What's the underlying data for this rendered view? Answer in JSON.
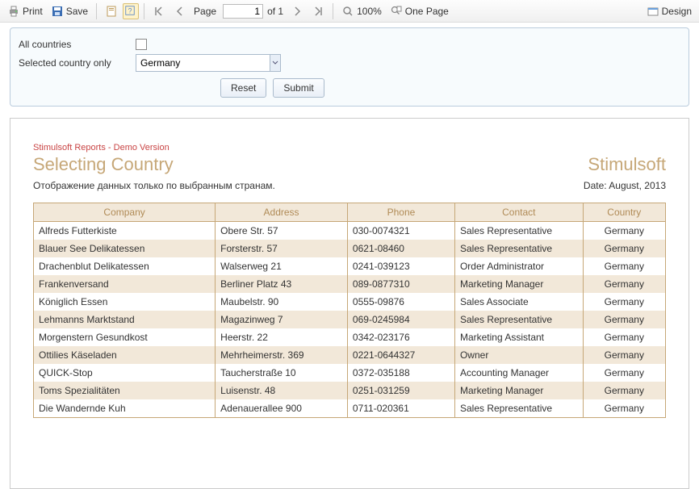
{
  "toolbar": {
    "print": "Print",
    "save": "Save",
    "page_label": "Page",
    "page_input": "1",
    "page_of": "of 1",
    "zoom": "100%",
    "one_page": "One Page",
    "design": "Design"
  },
  "params": {
    "all_label": "All countries",
    "selected_label": "Selected country only",
    "combo_value": "Germany",
    "reset": "Reset",
    "submit": "Submit"
  },
  "report": {
    "demo": "Stimulsoft Reports - Demo Version",
    "title": "Selecting Country",
    "brand": "Stimulsoft",
    "subtitle": "Отображение данных только по выбранным странам.",
    "date": "Date: August, 2013",
    "headers": {
      "company": "Company",
      "address": "Address",
      "phone": "Phone",
      "contact": "Contact",
      "country": "Country"
    },
    "rows": [
      {
        "company": "Alfreds Futterkiste",
        "address": "Obere Str. 57",
        "phone": "030-0074321",
        "contact": "Sales Representative",
        "country": "Germany"
      },
      {
        "company": "Blauer See Delikatessen",
        "address": "Forsterstr. 57",
        "phone": "0621-08460",
        "contact": "Sales Representative",
        "country": "Germany"
      },
      {
        "company": "Drachenblut Delikatessen",
        "address": "Walserweg 21",
        "phone": "0241-039123",
        "contact": "Order Administrator",
        "country": "Germany"
      },
      {
        "company": "Frankenversand",
        "address": "Berliner Platz 43",
        "phone": "089-0877310",
        "contact": "Marketing Manager",
        "country": "Germany"
      },
      {
        "company": "Königlich Essen",
        "address": "Maubelstr. 90",
        "phone": "0555-09876",
        "contact": "Sales Associate",
        "country": "Germany"
      },
      {
        "company": "Lehmanns Marktstand",
        "address": "Magazinweg 7",
        "phone": "069-0245984",
        "contact": "Sales Representative",
        "country": "Germany"
      },
      {
        "company": "Morgenstern Gesundkost",
        "address": "Heerstr. 22",
        "phone": "0342-023176",
        "contact": "Marketing Assistant",
        "country": "Germany"
      },
      {
        "company": "Ottilies Käseladen",
        "address": "Mehrheimerstr. 369",
        "phone": "0221-0644327",
        "contact": "Owner",
        "country": "Germany"
      },
      {
        "company": "QUICK-Stop",
        "address": "Taucherstraße 10",
        "phone": "0372-035188",
        "contact": "Accounting Manager",
        "country": "Germany"
      },
      {
        "company": "Toms Spezialitäten",
        "address": "Luisenstr. 48",
        "phone": "0251-031259",
        "contact": "Marketing Manager",
        "country": "Germany"
      },
      {
        "company": "Die Wandernde Kuh",
        "address": "Adenauerallee 900",
        "phone": "0711-020361",
        "contact": "Sales Representative",
        "country": "Germany"
      }
    ]
  }
}
